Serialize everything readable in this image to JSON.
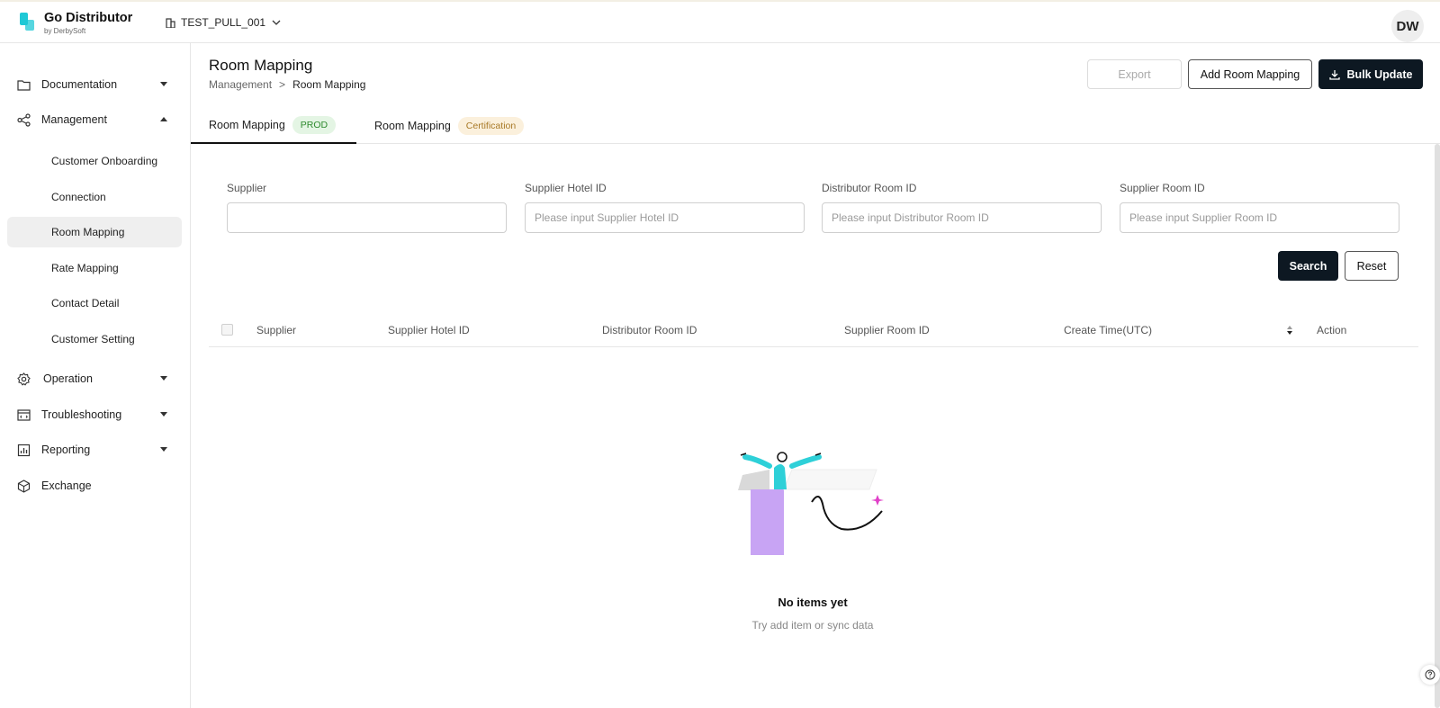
{
  "app": {
    "title": "Go Distributor",
    "subtitle": "by DerbySoft",
    "tenant": "TEST_PULL_001",
    "avatar_initials": "DW",
    "accent_color": "#1fc8d6"
  },
  "sidebar": {
    "items": [
      {
        "label": "Documentation",
        "icon": "folder-icon",
        "expandable": true,
        "expanded": false
      },
      {
        "label": "Management",
        "icon": "share-icon",
        "expandable": true,
        "expanded": true
      },
      {
        "label": "Operation",
        "icon": "gear-icon",
        "expandable": true,
        "expanded": false
      },
      {
        "label": "Troubleshooting",
        "icon": "browser-code-icon",
        "expandable": true,
        "expanded": false
      },
      {
        "label": "Reporting",
        "icon": "report-icon",
        "expandable": true,
        "expanded": false
      },
      {
        "label": "Exchange",
        "icon": "cube-icon",
        "expandable": false,
        "expanded": false
      }
    ],
    "management_children": [
      {
        "label": "Customer Onboarding",
        "active": false
      },
      {
        "label": "Connection",
        "active": false
      },
      {
        "label": "Room Mapping",
        "active": true
      },
      {
        "label": "Rate Mapping",
        "active": false
      },
      {
        "label": "Contact Detail",
        "active": false
      },
      {
        "label": "Customer Setting",
        "active": false
      }
    ]
  },
  "page": {
    "title": "Room Mapping",
    "breadcrumb": [
      "Management",
      ">",
      "Room Mapping"
    ]
  },
  "actions": {
    "export": "Export",
    "add": "Add Room Mapping",
    "bulk": "Bulk Update"
  },
  "tabs": [
    {
      "label": "Room Mapping",
      "tag": "PROD",
      "active": true
    },
    {
      "label": "Room Mapping",
      "tag": "Certification",
      "active": false
    }
  ],
  "filters": [
    {
      "label": "Supplier",
      "value": "",
      "placeholder": ""
    },
    {
      "label": "Supplier Hotel ID",
      "value": "",
      "placeholder": "Please input Supplier Hotel ID"
    },
    {
      "label": "Distributor Room ID",
      "value": "",
      "placeholder": "Please input Distributor Room ID"
    },
    {
      "label": "Supplier Room ID",
      "value": "",
      "placeholder": "Please input Supplier Room ID"
    }
  ],
  "filter_actions": {
    "search": "Search",
    "reset": "Reset"
  },
  "table": {
    "columns": [
      "Supplier",
      "Supplier Hotel ID",
      "Distributor Room ID",
      "Supplier Room ID",
      "Create Time(UTC)",
      "Action"
    ],
    "rows": []
  },
  "empty": {
    "title": "No items yet",
    "subtitle": "Try add item or sync data"
  }
}
